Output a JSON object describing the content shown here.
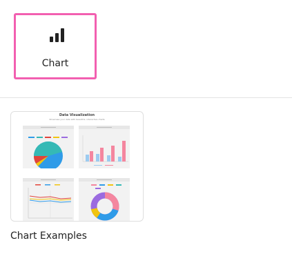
{
  "tile": {
    "label": "Chart",
    "icon": "bar-chart-icon",
    "selected": true,
    "accent": "#f25fb0"
  },
  "card": {
    "caption": "Chart Examples"
  },
  "thumbnail": {
    "title": "Data Visualization",
    "subtitle": "Showcase your data with beautiful, interactive charts"
  },
  "colors": {
    "blue": "#2f9be8",
    "teal": "#35b9b5",
    "pink": "#f4869f",
    "light_blue": "#9ccbf0",
    "red": "#e2433a",
    "yellow": "#f1c40f",
    "purple": "#9b6be0"
  }
}
